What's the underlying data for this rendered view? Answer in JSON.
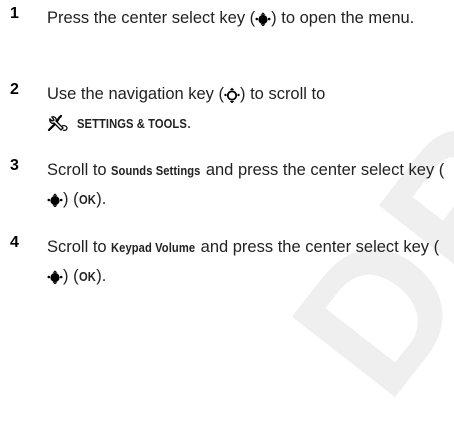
{
  "watermark": "DRAFT",
  "steps": [
    {
      "number": "1",
      "a": "Press the center select key (",
      "b": ") to open the menu."
    },
    {
      "number": "2",
      "a": "Use the navigation key (",
      "b": ") to scroll to",
      "menu": "SETTINGS & TOOLS",
      "c": "."
    },
    {
      "number": "3",
      "a": "Scroll to ",
      "bold": "Sounds Settings",
      "b": " and press the center select key (",
      "c": ") (",
      "ok": "OK",
      "d": ")."
    },
    {
      "number": "4",
      "a": "Scroll to ",
      "bold": "Keypad Volume",
      "b": " and press the center select key (",
      "c": ") (",
      "ok": "OK",
      "d": ")."
    }
  ],
  "icons": {
    "center_select": "center-select-key-icon",
    "navigation": "navigation-key-icon",
    "settings_tools": "settings-tools-icon"
  }
}
